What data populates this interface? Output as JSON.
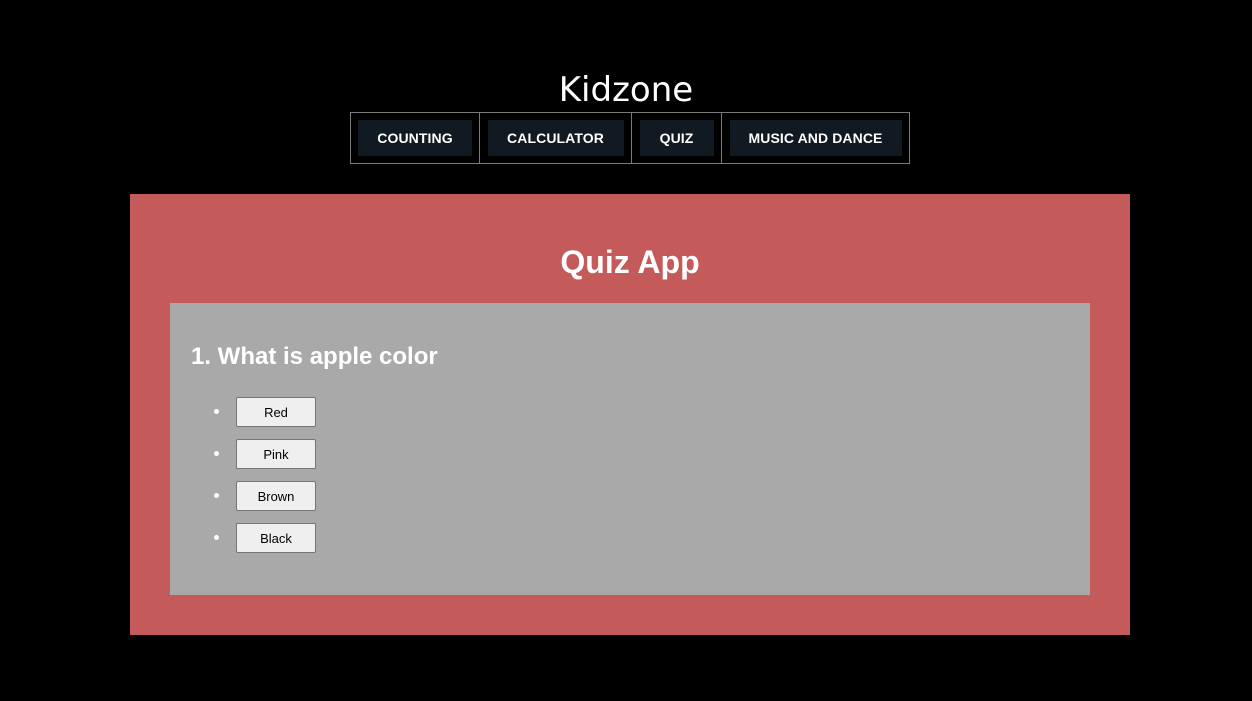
{
  "site": {
    "title": "Kidzone"
  },
  "nav": {
    "items": [
      {
        "label": "COUNTING"
      },
      {
        "label": "CALCULATOR"
      },
      {
        "label": "QUIZ"
      },
      {
        "label": "MUSIC AND DANCE"
      }
    ]
  },
  "quiz": {
    "title": "Quiz App",
    "question": "1. What is apple color",
    "options": [
      {
        "label": "Red"
      },
      {
        "label": "Pink"
      },
      {
        "label": "Brown"
      },
      {
        "label": "Black"
      }
    ]
  },
  "colors": {
    "background": "#000000",
    "nav_button": "#111923",
    "quiz_panel": "#c45a5a",
    "question_box": "#a9a9a9",
    "text": "#ffffff"
  }
}
